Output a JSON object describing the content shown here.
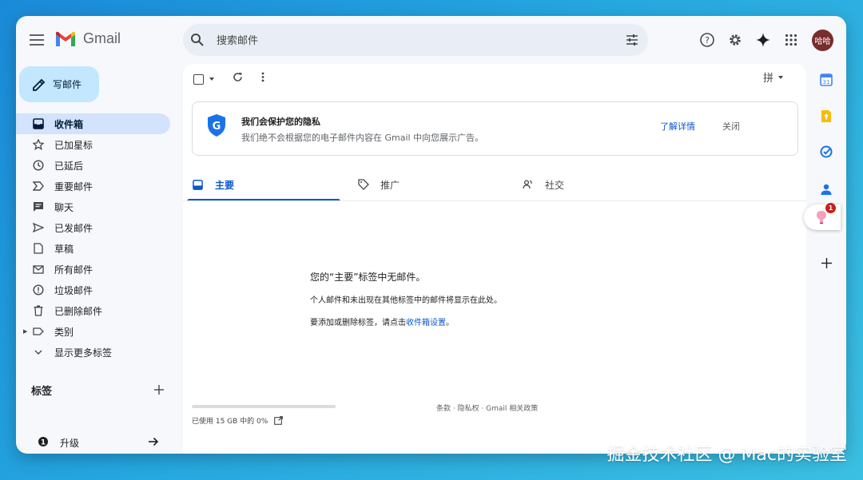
{
  "header": {
    "app_name": "Gmail",
    "search_placeholder": "搜索邮件",
    "avatar_text": "哈哈"
  },
  "sidebar": {
    "compose_label": "写邮件",
    "items": [
      {
        "label": "收件箱",
        "icon": "inbox-icon",
        "active": true
      },
      {
        "label": "已加星标",
        "icon": "star-icon"
      },
      {
        "label": "已延后",
        "icon": "clock-icon"
      },
      {
        "label": "重要邮件",
        "icon": "important-icon"
      },
      {
        "label": "聊天",
        "icon": "chat-icon"
      },
      {
        "label": "已发邮件",
        "icon": "send-icon"
      },
      {
        "label": "草稿",
        "icon": "draft-icon"
      },
      {
        "label": "所有邮件",
        "icon": "all-mail-icon"
      },
      {
        "label": "垃圾邮件",
        "icon": "spam-icon"
      },
      {
        "label": "已删除邮件",
        "icon": "trash-icon"
      },
      {
        "label": "类别",
        "icon": "label-icon"
      },
      {
        "label": "显示更多标签",
        "icon": "chevron-down-icon"
      }
    ],
    "labels_heading": "标签",
    "upgrade_label": "升级"
  },
  "toolbar": {
    "input_method": "拼"
  },
  "promo": {
    "title": "我们会保护您的隐私",
    "body": "我们绝不会根据您的电子邮件内容在 Gmail 中向您展示广告。",
    "learn_more": "了解详情",
    "close": "关闭"
  },
  "tabs": [
    {
      "label": "主要",
      "icon": "inbox-icon",
      "active": true
    },
    {
      "label": "推广",
      "icon": "tag-icon"
    },
    {
      "label": "社交",
      "icon": "people-icon"
    }
  ],
  "empty_state": {
    "title": "您的“主要”标签中无邮件。",
    "line1": "个人邮件和未出现在其他标签中的邮件将显示在此处。",
    "line2_prefix": "要添加或删除标签，请点击",
    "line2_link": "收件箱设置",
    "line2_suffix": "。"
  },
  "footer": {
    "storage": "已使用 15 GB 中的 0%",
    "storage_fraction": 0,
    "links": "条款 · 隐私权 · Gmail 相关政策"
  },
  "right_panel": {
    "badge_count": "1"
  },
  "watermark": "掘金技术社区 @ Mac的实验室"
}
